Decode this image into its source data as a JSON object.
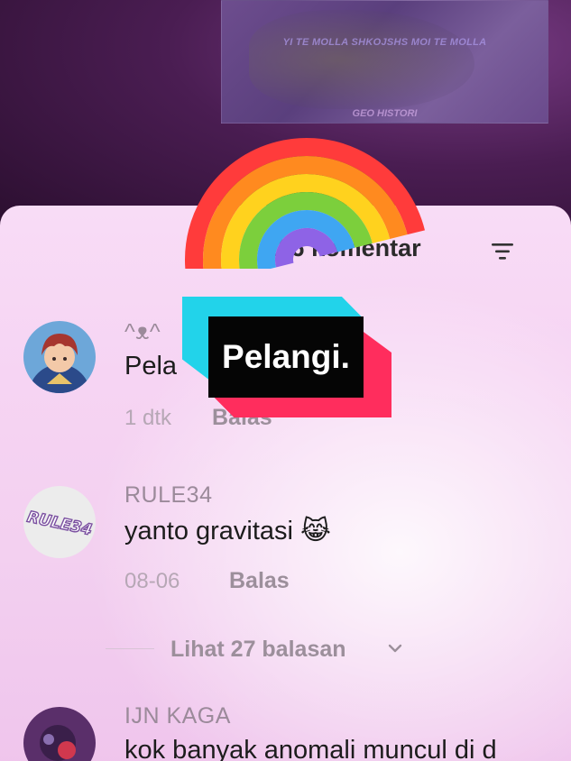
{
  "video": {
    "subtitle": "YI TE MOLLA SHKOJSHS MOI TE MOLLA",
    "watermark": "GEO HISTORI"
  },
  "header": {
    "comment_count_label": "6.236 komentar",
    "filter_icon": "filter-icon"
  },
  "comments": [
    {
      "username": "^ᴥ^",
      "text": "Pela",
      "time": "1 dtk",
      "reply_label": "Balas"
    },
    {
      "username": "RULE34",
      "text": "yanto gravitasi 😹",
      "time": "08-06",
      "reply_label": "Balas",
      "avatar_text": "RULE34"
    },
    {
      "username": "IJN KAGA",
      "text": "kok banyak anomali muncul di d"
    }
  ],
  "view_replies": {
    "label": "Lihat 27 balasan",
    "icon": "chevron-down-icon"
  },
  "overlay": {
    "caption": "Pelangi.",
    "sticker": "rainbow-emoji",
    "colors": {
      "caption_bg": "#050505",
      "caption_cyan": "#22d3ea",
      "caption_red": "#ff2d5d"
    }
  }
}
